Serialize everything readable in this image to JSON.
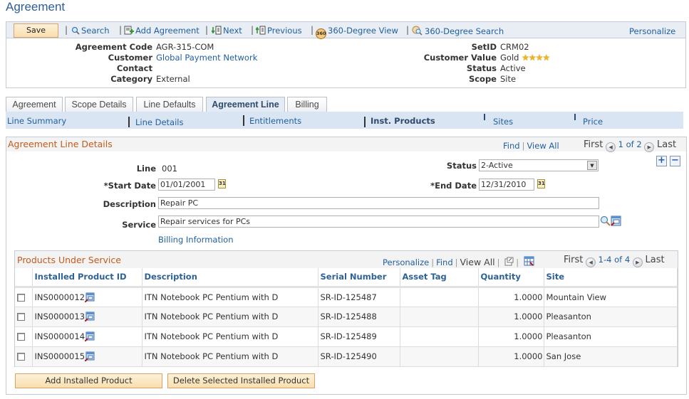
{
  "page": {
    "title": "Agreement"
  },
  "toolbar": {
    "save_label": "Save",
    "search_label": "Search",
    "add_agreement_label": "Add Agreement",
    "next_label": "Next",
    "previous_label": "Previous",
    "view360_label": "360-Degree View",
    "search360_label": "360-Degree Search",
    "personalize_label": "Personalize",
    "separator": "|",
    "badge_360": "360"
  },
  "header": {
    "agreement_code": {
      "label": "Agreement Code",
      "value": "AGR-315-COM"
    },
    "customer": {
      "label": "Customer",
      "value": "Global Payment Network"
    },
    "contact": {
      "label": "Contact",
      "value": ""
    },
    "category": {
      "label": "Category",
      "value": "External"
    },
    "setid": {
      "label": "SetID",
      "value": "CRM02"
    },
    "customer_value": {
      "label": "Customer Value",
      "value": "Gold",
      "stars": 4,
      "stars_text": "★★★★"
    },
    "status": {
      "label": "Status",
      "value": "Active"
    },
    "scope": {
      "label": "Scope",
      "value": "Site"
    }
  },
  "tabs": [
    {
      "label": "Agreement",
      "active": false
    },
    {
      "label": "Scope Details",
      "active": false
    },
    {
      "label": "Line Defaults",
      "active": false
    },
    {
      "label": "Agreement Line",
      "active": true
    },
    {
      "label": "Billing",
      "active": false
    }
  ],
  "subnav": [
    {
      "label": "Line Summary",
      "active": false
    },
    {
      "label": "Line Details",
      "active": false
    },
    {
      "label": "Entitlements",
      "active": false
    },
    {
      "label": "Inst. Products",
      "active": true
    },
    {
      "label": "Sites",
      "active": false
    },
    {
      "label": "Price",
      "active": false
    }
  ],
  "line_details": {
    "title": "Agreement Line Details",
    "find_label": "Find",
    "view_all_label": "View All",
    "first_label": "First",
    "last_label": "Last",
    "page_info": "1 of 2",
    "line": {
      "label": "Line",
      "value": "001"
    },
    "status": {
      "label": "Status",
      "value": "2-Active"
    },
    "start_date": {
      "label": "*Start Date",
      "value": "01/01/2001"
    },
    "end_date": {
      "label": "*End Date",
      "value": "12/31/2010"
    },
    "description": {
      "label": "Description",
      "value": "Repair PC"
    },
    "service": {
      "label": "Service",
      "value": "Repair services for PCs"
    },
    "billing_link": "Billing Information",
    "add_row": "+",
    "delete_row": "−",
    "calendar_glyph": "31"
  },
  "products": {
    "title": "Products Under Service",
    "personalize_label": "Personalize",
    "find_label": "Find",
    "view_all_label": "View All",
    "first_label": "First",
    "last_label": "Last",
    "page_info": "1-4 of 4",
    "columns": [
      "",
      "Installed Product ID",
      "Description",
      "Serial Number",
      "Asset Tag",
      "Quantity",
      "Site"
    ],
    "rows": [
      {
        "id": "INS0000012",
        "description": "ITN Notebook PC Pentium with D",
        "serial": "SR-ID-125487",
        "asset_tag": "",
        "quantity": "1.0000",
        "site": "Mountain View"
      },
      {
        "id": "INS0000013",
        "description": "ITN Notebook PC Pentium with D",
        "serial": "SR-ID-125488",
        "asset_tag": "",
        "quantity": "1.0000",
        "site": "Pleasanton"
      },
      {
        "id": "INS0000014",
        "description": "ITN Notebook PC Pentium with D",
        "serial": "SR-ID-125489",
        "asset_tag": "",
        "quantity": "1.0000",
        "site": "Pleasanton"
      },
      {
        "id": "INS0000015",
        "description": "ITN Notebook PC Pentium with D",
        "serial": "SR-ID-125490",
        "asset_tag": "",
        "quantity": "1.0000",
        "site": "San Jose"
      }
    ],
    "add_button": "Add Installed Product",
    "delete_button": "Delete Selected Installed Product"
  }
}
